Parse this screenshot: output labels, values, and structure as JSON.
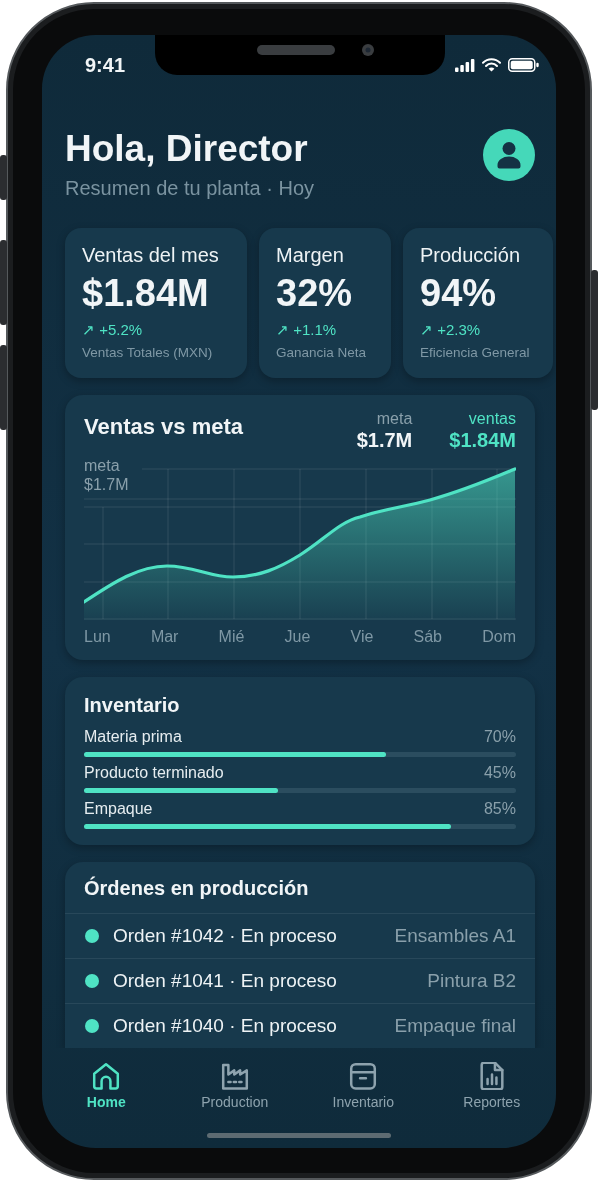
{
  "status_bar": {
    "time": "9:41"
  },
  "header": {
    "greeting": "Hola, Director",
    "subtitle": "Resumen de tu planta · Hoy"
  },
  "kpis": [
    {
      "title": "Ventas del mes",
      "value": "$1.84M",
      "delta": "↗ +5.2%",
      "caption": "Ventas Totales (MXN)"
    },
    {
      "title": "Margen",
      "value": "32%",
      "delta": "↗ +1.1%",
      "caption": "Ganancia Neta"
    },
    {
      "title": "Producción",
      "value": "94%",
      "delta": "↗ +2.3%",
      "caption": "Eficiencia General"
    }
  ],
  "sales_chart": {
    "title": "Ventas vs meta",
    "legend": [
      {
        "kind": "goal",
        "label": "meta",
        "value": "$1.7M"
      },
      {
        "kind": "actual",
        "label": "ventas",
        "value": "$1.84M"
      }
    ],
    "goal_annotation": {
      "label": "meta",
      "value": "$1.7M"
    },
    "x_labels": [
      "Lun",
      "Mar",
      "Mié",
      "Jue",
      "Vie",
      "Sáb",
      "Dom"
    ]
  },
  "inventory": {
    "title": "Inventario",
    "items": [
      {
        "label": "Materia prima",
        "percent": "70%",
        "level": 0.7
      },
      {
        "label": "Producto terminado",
        "percent": "45%",
        "level": 0.45
      },
      {
        "label": "Empaque",
        "percent": "85%",
        "level": 0.85
      }
    ]
  },
  "orders": {
    "title": "Órdenes en producción",
    "items": [
      {
        "label": "Orden #1042 · En proceso",
        "location": "Ensambles A1",
        "color": "#4fe3c4"
      },
      {
        "label": "Orden #1041 · En proceso",
        "location": "Pintura B2",
        "color": "#4fe3c4"
      },
      {
        "label": "Orden #1040 · En proceso",
        "location": "Empaque final",
        "color": "#4fe3c4"
      }
    ]
  },
  "tab_bar": {
    "items": [
      {
        "label": "Home",
        "selected": true
      },
      {
        "label": "Production",
        "selected": false
      },
      {
        "label": "Inventario",
        "selected": false
      },
      {
        "label": "Reportes",
        "selected": false
      }
    ]
  }
}
